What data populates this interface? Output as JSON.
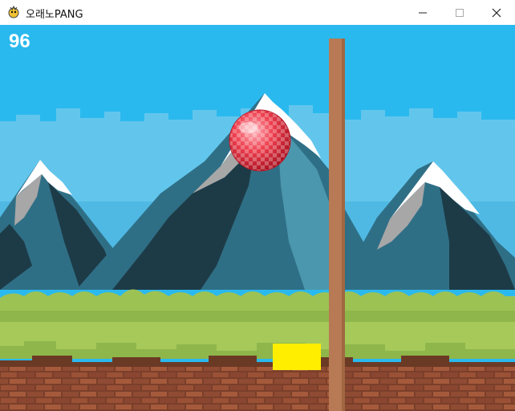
{
  "window": {
    "title": "오래노PANG",
    "icon": "pygame-snake-icon",
    "controls": {
      "minimize_icon": "minimize-icon",
      "maximize_icon": "maximize-icon",
      "close_icon": "close-icon"
    }
  },
  "hud": {
    "score": "96"
  },
  "colors": {
    "sky": "#2ab9ee",
    "mountain_dark": "#1d3b47",
    "mountain_mid": "#2f6f86",
    "mountain_light": "#4b97ad",
    "snow": "#ffffff",
    "rock_gray": "#a7a7a7",
    "grass_dark": "#8fb64a",
    "grass_light": "#a6c95a",
    "brick": "#8b4a33",
    "pole": "#b77a54",
    "player": "#ffee00",
    "ball": "#e6313f"
  }
}
